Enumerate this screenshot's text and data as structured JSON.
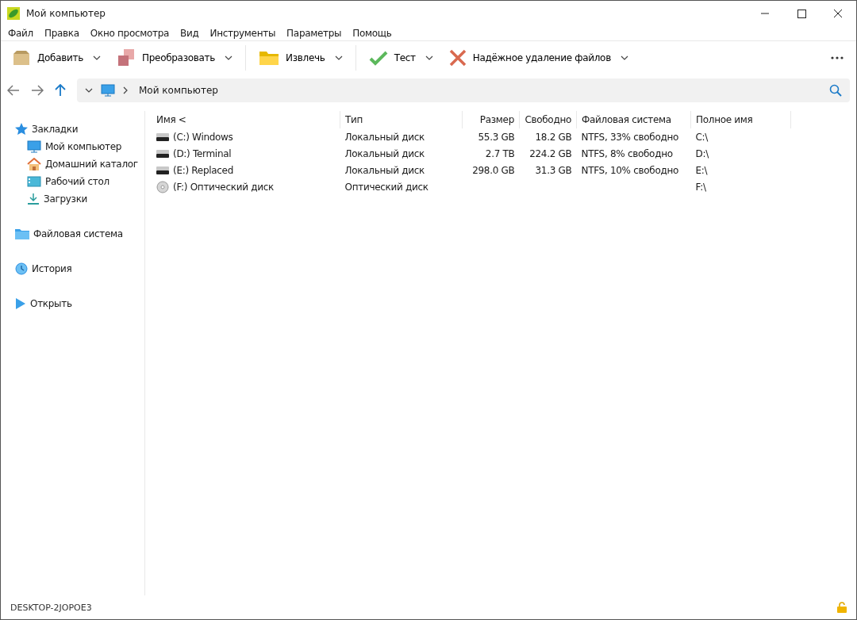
{
  "window": {
    "title": "Мой компьютер"
  },
  "menu": [
    "Файл",
    "Правка",
    "Окно просмотра",
    "Вид",
    "Инструменты",
    "Параметры",
    "Помощь"
  ],
  "toolbar": [
    {
      "kind": "add",
      "label": "Добавить"
    },
    {
      "kind": "convert",
      "label": "Преобразовать"
    },
    {
      "kind": "extract",
      "label": "Извлечь"
    },
    {
      "kind": "test",
      "label": "Тест"
    },
    {
      "kind": "wipe",
      "label": "Надёжное удаление файлов"
    }
  ],
  "address": {
    "path": "Мой компьютер"
  },
  "sidebar": [
    {
      "kind": "bookmarks",
      "label": "Закладки",
      "children": [
        {
          "kind": "computer",
          "label": "Мой компьютер"
        },
        {
          "kind": "home",
          "label": "Домашний каталог"
        },
        {
          "kind": "desktop",
          "label": "Рабочий стол"
        },
        {
          "kind": "downloads",
          "label": "Загрузки"
        }
      ]
    },
    {
      "kind": "filesystem",
      "label": "Файловая система"
    },
    {
      "kind": "history",
      "label": "История"
    },
    {
      "kind": "open",
      "label": "Открыть"
    }
  ],
  "table": {
    "columns": [
      "Имя <",
      "Тип",
      "Размер",
      "Свободно",
      "Файловая система",
      "Полное имя"
    ],
    "rows": [
      {
        "kind": "hdd",
        "cells": [
          "(C:) Windows",
          "Локальный диск",
          "55.3 GB",
          "18.2 GB",
          "NTFS, 33% свободно",
          "C:\\"
        ]
      },
      {
        "kind": "hdd",
        "cells": [
          "(D:) Terminal",
          "Локальный диск",
          "2.7 TB",
          "224.2 GB",
          "NTFS, 8% свободно",
          "D:\\"
        ]
      },
      {
        "kind": "hdd",
        "cells": [
          "(E:) Replaced",
          "Локальный диск",
          "298.0 GB",
          "31.3 GB",
          "NTFS, 10% свободно",
          "E:\\"
        ]
      },
      {
        "kind": "optical",
        "cells": [
          "(F:) Оптический диск",
          "Оптический диск",
          "",
          "",
          "",
          "F:\\"
        ]
      }
    ]
  },
  "status_bar": {
    "computer": "DESKTOP-2JOPOE3"
  }
}
